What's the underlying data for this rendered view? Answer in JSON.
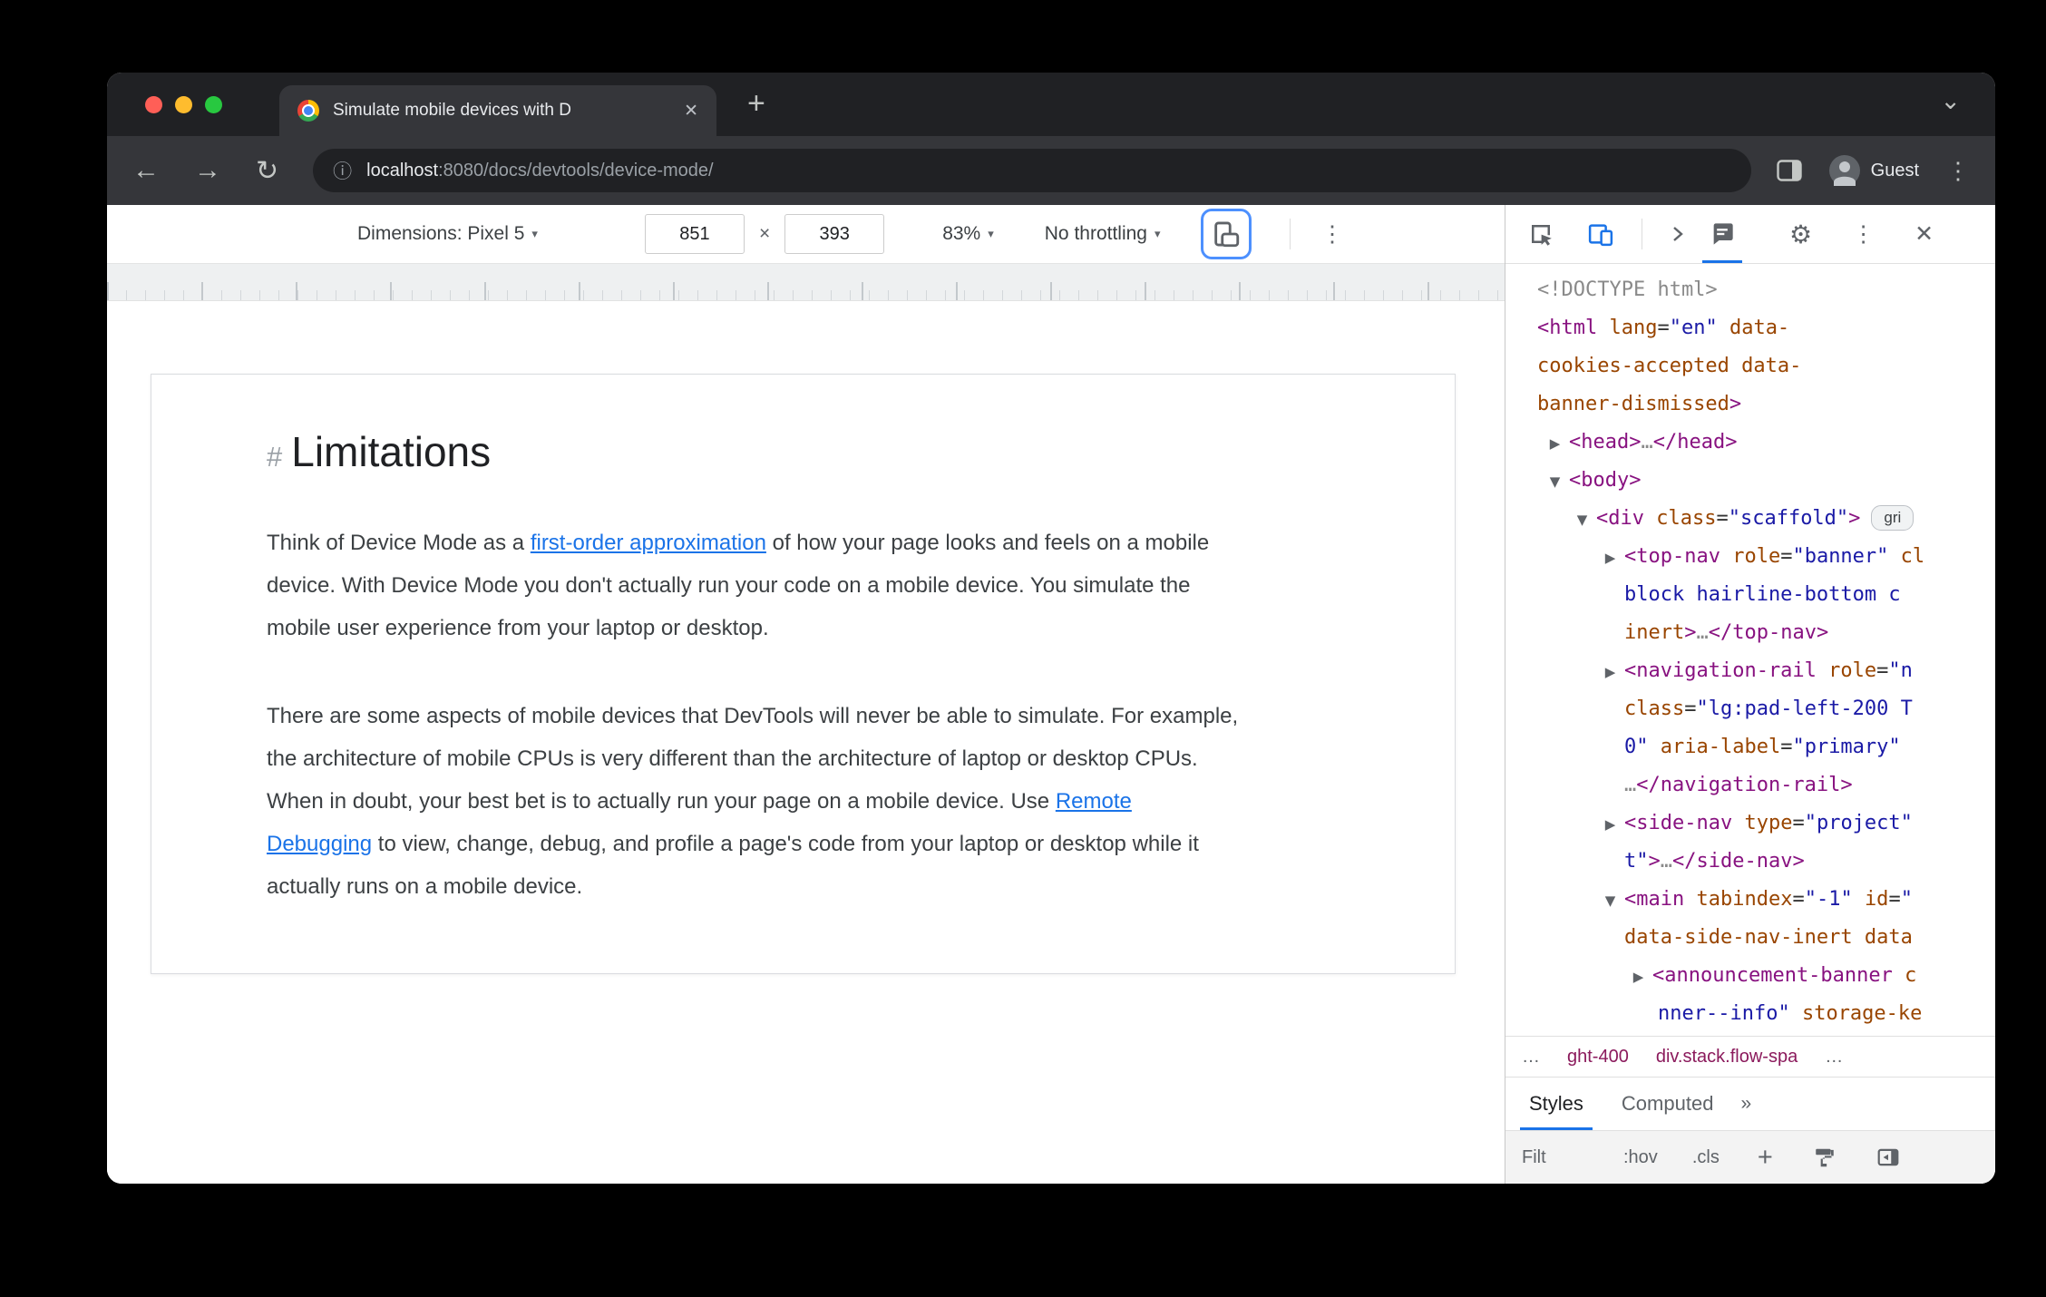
{
  "window": {
    "tab_title": "Simulate mobile devices with D",
    "url_host": "localhost",
    "url_rest": ":8080/docs/devtools/device-mode/",
    "guest_label": "Guest"
  },
  "device_toolbar": {
    "dimensions_label": "Dimensions: Pixel 5",
    "width_value": "851",
    "height_value": "393",
    "zoom_value": "83%",
    "throttling_value": "No throttling"
  },
  "page": {
    "hash": "#",
    "heading": "Limitations",
    "p1_before": "Think of Device Mode as a ",
    "p1_link": "first-order approximation",
    "p1_after": " of how your page looks and feels on a mobile device. With Device Mode you don't actually run your code on a mobile device. You simulate the mobile user experience from your laptop or desktop.",
    "p2_before": "There are some aspects of mobile devices that DevTools will never be able to simulate. For example, the architecture of mobile CPUs is very different than the architecture of laptop or desktop CPUs. When in doubt, your best bet is to actually run your page on a mobile device. Use ",
    "p2_link": "Remote Debugging",
    "p2_after": " to view, change, debug, and profile a page's code from your laptop or desktop while it actually runs on a mobile device."
  },
  "devtools": {
    "dom_lines": [
      {
        "pad": 35,
        "seg": [
          [
            "g",
            "<!DOCTYPE html>"
          ]
        ]
      },
      {
        "pad": 35,
        "seg": [
          [
            "t",
            "<html"
          ],
          [
            "p",
            " "
          ],
          [
            "a",
            "lang"
          ],
          [
            "p",
            "="
          ],
          [
            "v",
            "\"en\""
          ],
          [
            "p",
            " "
          ],
          [
            "a",
            "data-"
          ]
        ]
      },
      {
        "pad": 35,
        "seg": [
          [
            "a",
            "cookies-accepted"
          ],
          [
            "p",
            " "
          ],
          [
            "a",
            "data-"
          ]
        ]
      },
      {
        "pad": 35,
        "seg": [
          [
            "a",
            "banner-dismissed"
          ],
          [
            "t",
            ">"
          ]
        ]
      },
      {
        "pad": 44,
        "arrow": "c",
        "seg": [
          [
            "t",
            "<head>"
          ],
          [
            "g",
            "…"
          ],
          [
            "t",
            "</head>"
          ]
        ]
      },
      {
        "pad": 44,
        "arrow": "e",
        "seg": [
          [
            "t",
            "<body>"
          ]
        ]
      },
      {
        "pad": 74,
        "arrow": "e",
        "seg": [
          [
            "t",
            "<div"
          ],
          [
            "p",
            " "
          ],
          [
            "a",
            "class"
          ],
          [
            "p",
            "="
          ],
          [
            "v",
            "\"scaffold\""
          ],
          [
            "t",
            ">"
          ]
        ],
        "badge": "gri"
      },
      {
        "pad": 105,
        "arrow": "c",
        "seg": [
          [
            "t",
            "<top-nav"
          ],
          [
            "p",
            " "
          ],
          [
            "a",
            "role"
          ],
          [
            "p",
            "="
          ],
          [
            "v",
            "\"banner\""
          ],
          [
            "p",
            " "
          ],
          [
            "a",
            "cl"
          ]
        ]
      },
      {
        "pad": 131,
        "seg": [
          [
            "v",
            "block hairline-bottom c"
          ]
        ]
      },
      {
        "pad": 131,
        "seg": [
          [
            "a",
            "inert"
          ],
          [
            "t",
            ">"
          ],
          [
            "g",
            "…"
          ],
          [
            "t",
            "</top-nav>"
          ]
        ]
      },
      {
        "pad": 105,
        "arrow": "c",
        "seg": [
          [
            "t",
            "<navigation-rail"
          ],
          [
            "p",
            " "
          ],
          [
            "a",
            "role"
          ],
          [
            "p",
            "="
          ],
          [
            "v",
            "\"n"
          ]
        ]
      },
      {
        "pad": 131,
        "seg": [
          [
            "a",
            "class"
          ],
          [
            "p",
            "="
          ],
          [
            "v",
            "\"lg:pad-left-200 T"
          ]
        ]
      },
      {
        "pad": 131,
        "seg": [
          [
            "v",
            "0\""
          ],
          [
            "p",
            " "
          ],
          [
            "a",
            "aria-label"
          ],
          [
            "p",
            "="
          ],
          [
            "v",
            "\"primary\""
          ]
        ]
      },
      {
        "pad": 131,
        "seg": [
          [
            "g",
            "…"
          ],
          [
            "t",
            "</navigation-rail>"
          ]
        ]
      },
      {
        "pad": 105,
        "arrow": "c",
        "seg": [
          [
            "t",
            "<side-nav"
          ],
          [
            "p",
            " "
          ],
          [
            "a",
            "type"
          ],
          [
            "p",
            "="
          ],
          [
            "v",
            "\"project\""
          ]
        ]
      },
      {
        "pad": 131,
        "seg": [
          [
            "v",
            "t\""
          ],
          [
            "t",
            ">"
          ],
          [
            "g",
            "…"
          ],
          [
            "t",
            "</side-nav>"
          ]
        ]
      },
      {
        "pad": 105,
        "arrow": "e",
        "seg": [
          [
            "t",
            "<main"
          ],
          [
            "p",
            " "
          ],
          [
            "a",
            "tabindex"
          ],
          [
            "p",
            "="
          ],
          [
            "v",
            "\"-1\""
          ],
          [
            "p",
            " "
          ],
          [
            "a",
            "id"
          ],
          [
            "p",
            "="
          ],
          [
            "v",
            "\""
          ]
        ]
      },
      {
        "pad": 131,
        "seg": [
          [
            "a",
            "data-side-nav-inert"
          ],
          [
            "p",
            " "
          ],
          [
            "a",
            "data"
          ]
        ]
      },
      {
        "pad": 136,
        "arrow": "c",
        "seg": [
          [
            "t",
            "<announcement-banner"
          ],
          [
            "p",
            " "
          ],
          [
            "a",
            "c"
          ]
        ]
      },
      {
        "pad": 168,
        "seg": [
          [
            "v",
            "nner--info\""
          ],
          [
            "p",
            " "
          ],
          [
            "a",
            "storage-ke"
          ]
        ]
      }
    ],
    "crumbs": [
      "…",
      "ght-400",
      "div.stack.flow-spa",
      "…"
    ],
    "styles_tab": "Styles",
    "computed_tab": "Computed",
    "filter_placeholder": "Filt",
    "hov_label": ":hov",
    "cls_label": ".cls"
  },
  "icons": {
    "back-icon": "←",
    "forward-icon": "→",
    "reload-icon": "↻",
    "info-icon": "ⓘ",
    "more-vert-icon": "⋮",
    "new-tab-icon": "+",
    "chevron-down-icon": "⌄",
    "close-icon": "✕",
    "dropdown-caret-icon": "▾",
    "dimension-times-icon": "×",
    "gear-icon": "⚙",
    "overflow-chevrons-icon": "»",
    "plus-icon": "+"
  }
}
